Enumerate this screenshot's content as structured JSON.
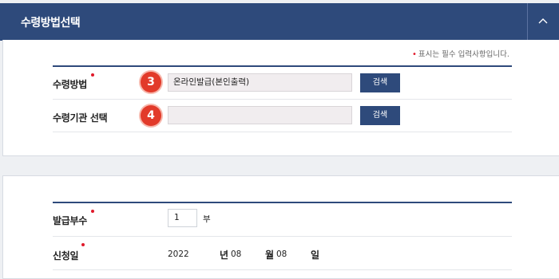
{
  "header": {
    "title": "수령방법선택"
  },
  "required_note": "표시는 필수 입력사항입니다.",
  "receive_method": {
    "label": "수령방법",
    "step": "3",
    "value": "온라인발급(본인출력)",
    "search_label": "검색"
  },
  "receive_agency": {
    "label": "수령기관 선택",
    "step": "4",
    "value": "",
    "search_label": "검색"
  },
  "copies": {
    "label": "발급부수",
    "value": "1",
    "unit": "부"
  },
  "apply_date": {
    "label": "신청일",
    "year": "2022",
    "year_unit": "년",
    "month": "08",
    "month_unit": "월",
    "day": "08",
    "day_unit": "일"
  },
  "colors": {
    "header_bg": "#2e4a7b",
    "badge": "#e23a2a",
    "required_dot": "#e01a2b"
  },
  "icons": {
    "collapse": "chevron-up-icon"
  }
}
